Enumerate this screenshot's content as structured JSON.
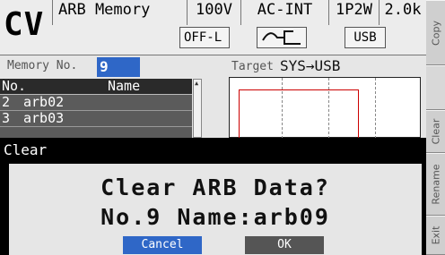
{
  "header": {
    "mode": "CV",
    "title": "ARB Memory",
    "voltage": "100V",
    "source": "AC-INT",
    "phase": "1P2W",
    "range": "2.0k",
    "output_state": "OFF-L",
    "storage_badge": "USB",
    "wave_icon": "ac-waveform-icon"
  },
  "memory": {
    "label": "Memory No.",
    "value": "9",
    "target_label": "Target",
    "target_value": "SYS→USB"
  },
  "table": {
    "headers": [
      "No.",
      "Name"
    ],
    "rows": [
      {
        "no": "2",
        "name": "arb02"
      },
      {
        "no": "3",
        "name": "arb03"
      }
    ]
  },
  "dialog": {
    "title": "Clear",
    "question": "Clear ARB Data?",
    "info": "No.9 Name:arb09",
    "cancel_label": "Cancel",
    "ok_label": "OK"
  },
  "softkeys": [
    "Copy",
    "Clear",
    "Rename",
    "Exit"
  ],
  "colors": {
    "accent_blue": "#2f67c7",
    "dialog_bg": "#000000",
    "waveform_red": "#cc0000"
  }
}
